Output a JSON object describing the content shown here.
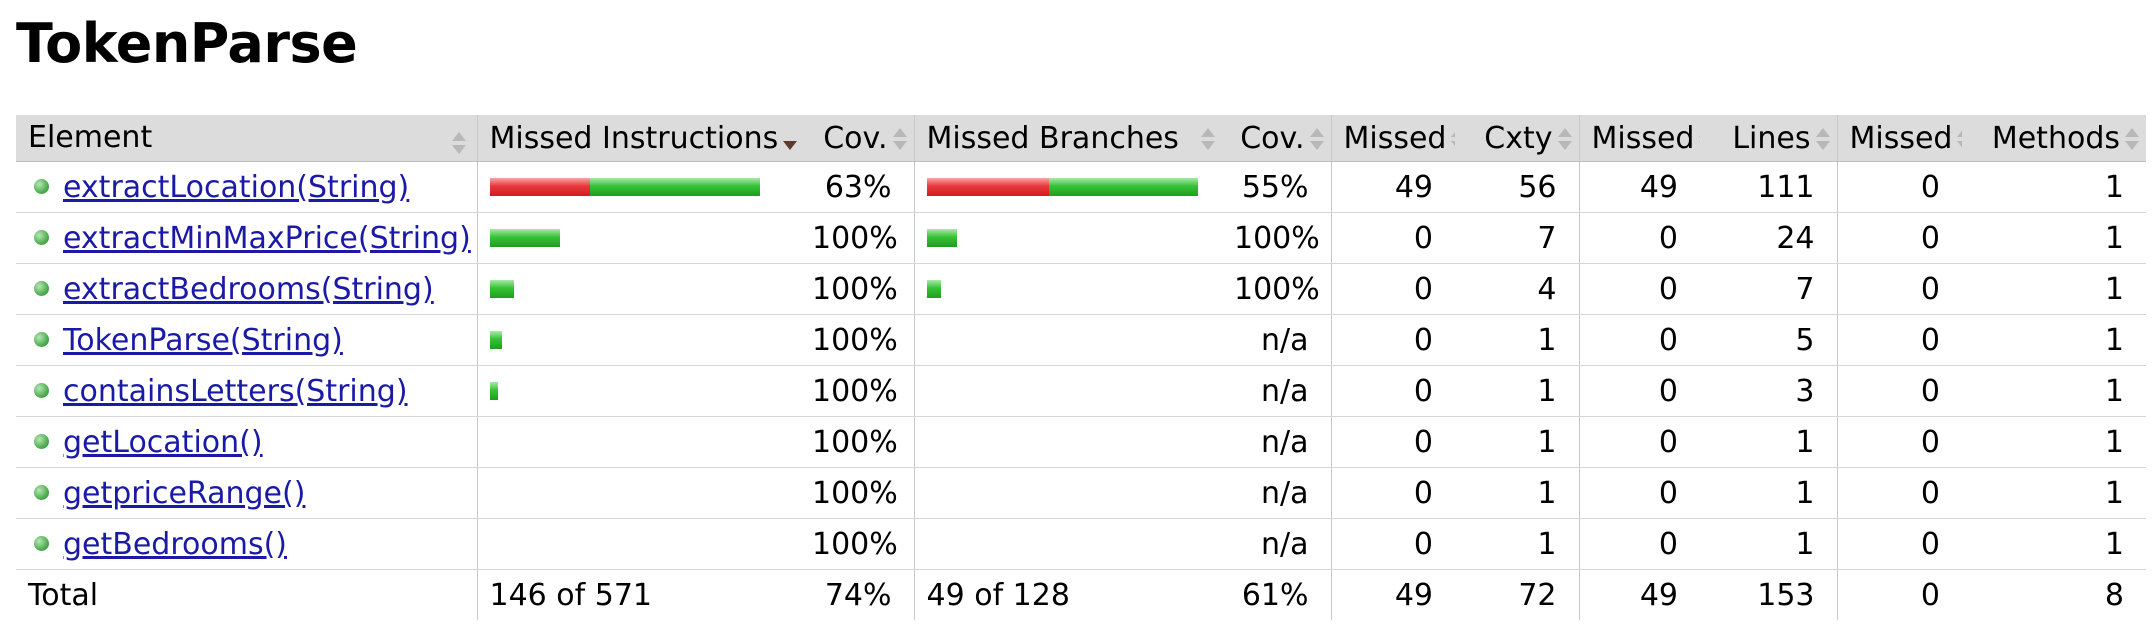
{
  "title": "TokenParse",
  "headers": {
    "element": "Element",
    "missed_instructions": "Missed Instructions",
    "cov_instructions": "Cov.",
    "missed_branches": "Missed Branches",
    "cov_branches": "Cov.",
    "missed_cxty": "Missed",
    "cxty": "Cxty",
    "missed_lines": "Missed",
    "lines": "Lines",
    "missed_methods": "Missed",
    "methods": "Methods"
  },
  "rows": [
    {
      "name": "extractLocation(String)",
      "instr_missed_ratio": 0.37,
      "instr_covered_ratio": 0.63,
      "instr_cov": "63%",
      "branch_missed_ratio": 0.45,
      "branch_covered_ratio": 0.55,
      "branch_cov": "55%",
      "missed_cxty": "49",
      "cxty": "56",
      "missed_lines": "49",
      "lines": "111",
      "missed_methods": "0",
      "methods": "1"
    },
    {
      "name": "extractMinMaxPrice(String)",
      "instr_missed_ratio": 0,
      "instr_covered_ratio": 0.26,
      "instr_cov": "100%",
      "branch_missed_ratio": 0,
      "branch_covered_ratio": 0.11,
      "branch_cov": "100%",
      "missed_cxty": "0",
      "cxty": "7",
      "missed_lines": "0",
      "lines": "24",
      "missed_methods": "0",
      "methods": "1"
    },
    {
      "name": "extractBedrooms(String)",
      "instr_missed_ratio": 0,
      "instr_covered_ratio": 0.09,
      "instr_cov": "100%",
      "branch_missed_ratio": 0,
      "branch_covered_ratio": 0.05,
      "branch_cov": "100%",
      "missed_cxty": "0",
      "cxty": "4",
      "missed_lines": "0",
      "lines": "7",
      "missed_methods": "0",
      "methods": "1"
    },
    {
      "name": "TokenParse(String)",
      "instr_missed_ratio": 0,
      "instr_covered_ratio": 0.045,
      "instr_cov": "100%",
      "branch_missed_ratio": 0,
      "branch_covered_ratio": 0,
      "branch_cov": "n/a",
      "missed_cxty": "0",
      "cxty": "1",
      "missed_lines": "0",
      "lines": "5",
      "missed_methods": "0",
      "methods": "1"
    },
    {
      "name": "containsLetters(String)",
      "instr_missed_ratio": 0,
      "instr_covered_ratio": 0.03,
      "instr_cov": "100%",
      "branch_missed_ratio": 0,
      "branch_covered_ratio": 0,
      "branch_cov": "n/a",
      "missed_cxty": "0",
      "cxty": "1",
      "missed_lines": "0",
      "lines": "3",
      "missed_methods": "0",
      "methods": "1"
    },
    {
      "name": "getLocation()",
      "instr_missed_ratio": 0,
      "instr_covered_ratio": 0,
      "instr_cov": "100%",
      "branch_missed_ratio": 0,
      "branch_covered_ratio": 0,
      "branch_cov": "n/a",
      "missed_cxty": "0",
      "cxty": "1",
      "missed_lines": "0",
      "lines": "1",
      "missed_methods": "0",
      "methods": "1"
    },
    {
      "name": "getpriceRange()",
      "instr_missed_ratio": 0,
      "instr_covered_ratio": 0,
      "instr_cov": "100%",
      "branch_missed_ratio": 0,
      "branch_covered_ratio": 0,
      "branch_cov": "n/a",
      "missed_cxty": "0",
      "cxty": "1",
      "missed_lines": "0",
      "lines": "1",
      "missed_methods": "0",
      "methods": "1"
    },
    {
      "name": "getBedrooms()",
      "instr_missed_ratio": 0,
      "instr_covered_ratio": 0,
      "instr_cov": "100%",
      "branch_missed_ratio": 0,
      "branch_covered_ratio": 0,
      "branch_cov": "n/a",
      "missed_cxty": "0",
      "cxty": "1",
      "missed_lines": "0",
      "lines": "1",
      "missed_methods": "0",
      "methods": "1"
    }
  ],
  "total": {
    "label": "Total",
    "instr": "146 of 571",
    "instr_cov": "74%",
    "branch": "49 of 128",
    "branch_cov": "61%",
    "missed_cxty": "49",
    "cxty": "72",
    "missed_lines": "49",
    "lines": "153",
    "missed_methods": "0",
    "methods": "8"
  },
  "colors": {
    "header_bg": "#dcdcdc",
    "link": "#1a1aa6",
    "bar_missed": "#e8383b",
    "bar_covered": "#36c236"
  }
}
